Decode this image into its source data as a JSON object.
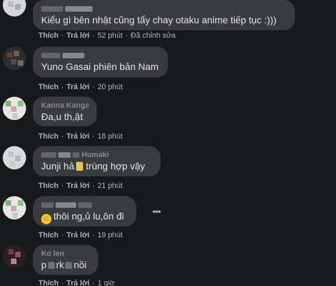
{
  "comments": [
    {
      "text": "Kiểu gì bên nhật cũng tẩy chay otaku anime tiếp tục :)))",
      "like": "Thích",
      "reply": "Trả lời",
      "time": "52 phút",
      "edited": "Đã chỉnh sửa"
    },
    {
      "text": "Yuno Gasai phiên bản Nam",
      "like": "Thích",
      "reply": "Trả lời",
      "time": "20 phút"
    },
    {
      "author_fragment": "Kanna Kanga",
      "text": "Đa,u th,ật",
      "like": "Thích",
      "reply": "Trả lời",
      "time": "18 phút"
    },
    {
      "author_fragment": "Humaki",
      "text_before": "Junji hả",
      "text_after": "trùng hợp vậy",
      "like": "Thích",
      "reply": "Trả lời",
      "time": "21 phút"
    },
    {
      "text": "thôi ng,ủ lu,ôn đi",
      "emoji": "smiling-face-emoji",
      "like": "Thích",
      "reply": "Trả lời",
      "time": "19 phút",
      "more_icon": "more-horizontal-icon"
    },
    {
      "author_fragment": "Ko len",
      "text_before": "p",
      "text_mid": "rk",
      "text_after": "nồi",
      "like": "Thích",
      "reply": "Trả lời",
      "time": "1 giờ"
    }
  ],
  "colors": {
    "background": "#18191a",
    "bubble": "#3a3b3c",
    "primary_text": "#e4e6eb",
    "secondary_text": "#b0b3b8"
  }
}
